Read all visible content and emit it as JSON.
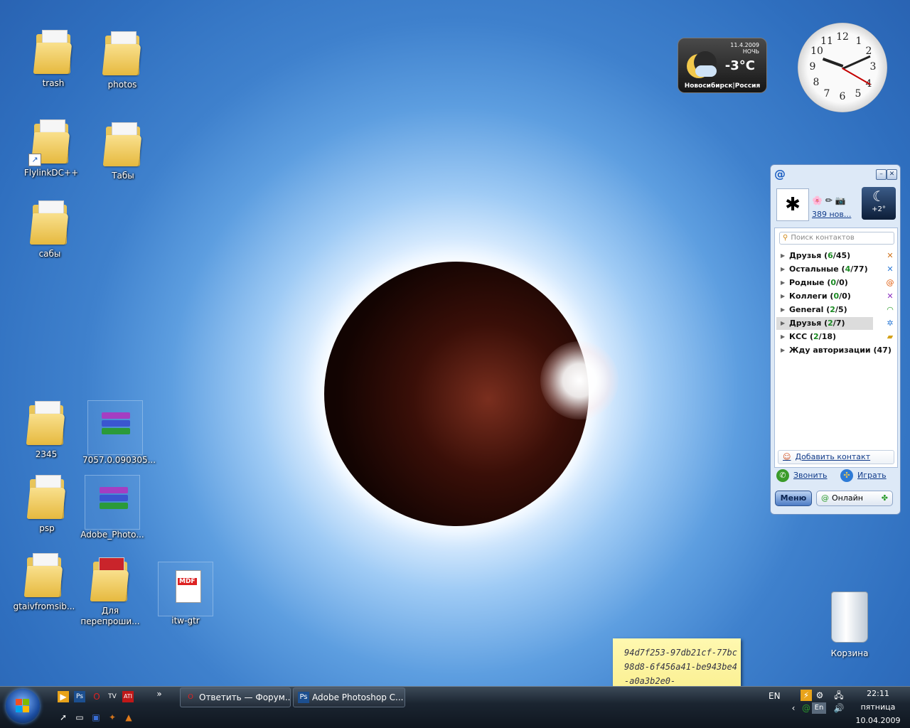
{
  "desktop_icons": [
    {
      "label": "trash"
    },
    {
      "label": "photos"
    },
    {
      "label": "FlylinkDC++"
    },
    {
      "label": "Табы"
    },
    {
      "label": "сабы"
    },
    {
      "label": "2345"
    },
    {
      "label": "7057.0.090305..."
    },
    {
      "label": "psp"
    },
    {
      "label": "Adobe_Photo..."
    },
    {
      "label": "gtaivfromsib..."
    },
    {
      "label": "Для перепроши..."
    },
    {
      "label": "itw-gtr"
    }
  ],
  "pdf_badge": "MDF",
  "weather_gadget": {
    "date": "11.4.2009",
    "period": "НОЧЬ",
    "temperature": "-3°C",
    "city": "Новосибирск|Россия"
  },
  "clock_gadget": {
    "numbers": [
      "12",
      "1",
      "2",
      "3",
      "4",
      "5",
      "6",
      "7",
      "8",
      "9",
      "10",
      "11"
    ]
  },
  "agent": {
    "mail_count": "389 нов...",
    "mini_weather_temp": "+2°",
    "search_placeholder": "Поиск контактов",
    "groups": [
      {
        "name": "Друзья",
        "online": "6",
        "total": "45"
      },
      {
        "name": "Остальные",
        "online": "4",
        "total": "77"
      },
      {
        "name": "Родные",
        "online": "0",
        "total": "0"
      },
      {
        "name": "Коллеги",
        "online": "0",
        "total": "0"
      },
      {
        "name": "General",
        "online": "2",
        "total": "5"
      },
      {
        "name": "Друзья",
        "online": "2",
        "total": "7"
      },
      {
        "name": "КСС",
        "online": "2",
        "total": "18"
      },
      {
        "name": "Жду авторизации",
        "online": "",
        "total": "47"
      }
    ],
    "add_contact": "Добавить контакт",
    "call": "Звонить",
    "play": "Играть",
    "menu": "Меню",
    "status": "Онлайн"
  },
  "recycle_bin": {
    "label": "Корзина"
  },
  "sticky_note": {
    "text": "94d7f253-97db21cf-77bc98d8-6f456a41-be943be4-a0a3b2e0-"
  },
  "taskbar": {
    "buttons": [
      {
        "label": "Ответить — Форум..."
      },
      {
        "label": "Adobe Photoshop C..."
      }
    ],
    "language": "EN",
    "tray_lang": "En",
    "time": "22:11",
    "weekday": "пятница",
    "date": "10.04.2009"
  },
  "colors": {
    "accent": "#1c5fc2",
    "online_count": "#1a8a22"
  }
}
